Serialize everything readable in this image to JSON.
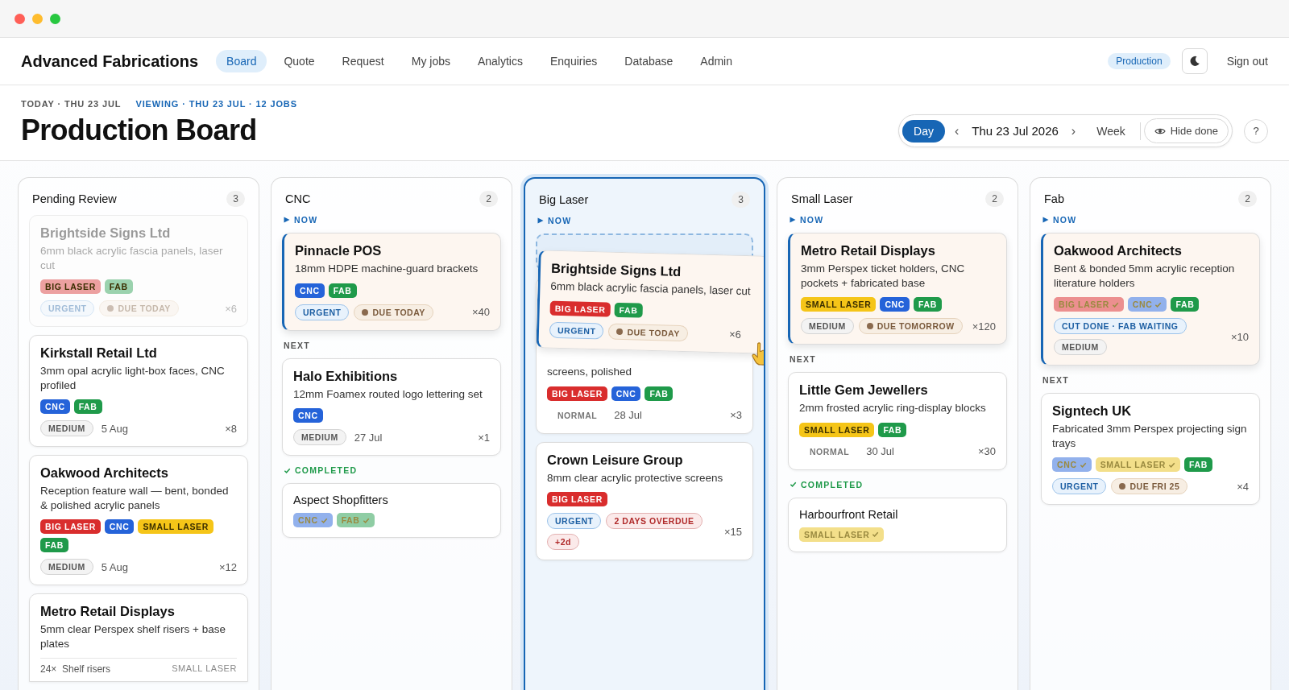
{
  "nav": {
    "brand": "Advanced Fabrications",
    "tabs": [
      {
        "label": "Board",
        "selected": true
      },
      {
        "label": "Quote",
        "selected": false
      },
      {
        "label": "Request",
        "selected": false
      },
      {
        "label": "My jobs",
        "selected": false
      },
      {
        "label": "Analytics",
        "selected": false
      },
      {
        "label": "Enquiries",
        "selected": false
      },
      {
        "label": "Database",
        "selected": false
      },
      {
        "label": "Admin",
        "selected": false
      }
    ],
    "environment": "Production",
    "sign_out": "Sign out"
  },
  "header": {
    "today": "TODAY · THU 23 JUL",
    "viewing": "VIEWING · THU 23 JUL · 12 JOBS",
    "title": "Production Board",
    "views": [
      {
        "label": "Day",
        "selected": true
      },
      {
        "label": "Week",
        "selected": false
      }
    ],
    "prev": "‹",
    "date": "Thu 23 Jul 2026",
    "next": "›",
    "hide_done": "Hide done",
    "help": "?"
  },
  "columns": [
    {
      "title": "Pending Review",
      "count": "3",
      "selected": false,
      "sections": [
        {
          "kind": "plain",
          "cards": [
            {
              "kind": "full",
              "faded": true,
              "active": false,
              "title": "Brightside Signs Ltd",
              "description": "6mm black acrylic fascia panels, laser cut",
              "stations": [
                {
                  "label": "BIG LASER",
                  "color": "#eca0a0",
                  "done": false
                },
                {
                  "label": "FAB",
                  "color": "#9bd2ae",
                  "done": false
                }
              ],
              "chips": [
                {
                  "kind": "urgent",
                  "label": "URGENT"
                },
                {
                  "kind": "due",
                  "label": "DUE TODAY"
                }
              ],
              "qty": "×6"
            },
            {
              "kind": "full",
              "faded": false,
              "active": false,
              "title": "Kirkstall Retail Ltd",
              "description": "3mm opal acrylic light-box faces, CNC profiled",
              "stations": [
                {
                  "label": "CNC",
                  "color": "#2563d9",
                  "done": false
                },
                {
                  "label": "FAB",
                  "color": "#1f9a4a",
                  "done": false
                }
              ],
              "chips": [
                {
                  "kind": "medium",
                  "label": "MEDIUM"
                }
              ],
              "date": "5 Aug",
              "qty": "×8"
            },
            {
              "kind": "full",
              "faded": false,
              "active": false,
              "title": "Oakwood Architects",
              "description": "Reception feature wall — bent, bonded & polished acrylic panels",
              "stations": [
                {
                  "label": "BIG LASER",
                  "color": "#d92d2d",
                  "done": false
                },
                {
                  "label": "CNC",
                  "color": "#2563d9",
                  "done": false
                },
                {
                  "label": "SMALL LASER",
                  "color": "#f5c518",
                  "done": false
                },
                {
                  "label": "FAB",
                  "color": "#1f9a4a",
                  "done": false
                }
              ],
              "chips": [
                {
                  "kind": "medium",
                  "label": "MEDIUM"
                }
              ],
              "date": "5 Aug",
              "qty": "×12"
            },
            {
              "kind": "summary",
              "title": "Metro Retail Displays",
              "description": "5mm clear Perspex shelf risers + base plates",
              "lines": [
                {
                  "qty": "24×",
                  "name": "Shelf risers",
                  "station": "SMALL LASER"
                }
              ]
            }
          ]
        }
      ]
    },
    {
      "title": "CNC",
      "count": "2",
      "selected": false,
      "sections": [
        {
          "kind": "now",
          "label": "NOW",
          "cards": [
            {
              "kind": "full",
              "faded": false,
              "active": true,
              "title": "Pinnacle POS",
              "description": "18mm HDPE machine-guard brackets",
              "stations": [
                {
                  "label": "CNC",
                  "color": "#2563d9",
                  "done": false
                },
                {
                  "label": "FAB",
                  "color": "#1f9a4a",
                  "done": false
                }
              ],
              "chips": [
                {
                  "kind": "urgent",
                  "label": "URGENT"
                },
                {
                  "kind": "due",
                  "label": "DUE TODAY"
                }
              ],
              "qty": "×40"
            }
          ]
        },
        {
          "kind": "next",
          "label": "NEXT",
          "cards": [
            {
              "kind": "full",
              "faded": false,
              "active": false,
              "title": "Halo Exhibitions",
              "description": "12mm Foamex routed logo lettering set",
              "stations": [
                {
                  "label": "CNC",
                  "color": "#2563d9",
                  "done": false
                }
              ],
              "chips": [
                {
                  "kind": "medium",
                  "label": "MEDIUM"
                }
              ],
              "date": "27 Jul",
              "qty": "×1"
            }
          ]
        },
        {
          "kind": "completed",
          "label": "COMPLETED",
          "cards": [
            {
              "kind": "done",
              "title": "Aspect Shopfitters",
              "stations": [
                {
                  "label": "CNC",
                  "color": "#92b1ec",
                  "done": true
                },
                {
                  "label": "FAB",
                  "color": "#8fcda4",
                  "done": true
                }
              ]
            }
          ]
        }
      ]
    },
    {
      "title": "Big Laser",
      "count": "3",
      "selected": true,
      "sections": [
        {
          "kind": "now",
          "label": "NOW",
          "cards": [
            {
              "kind": "dragged",
              "active": true,
              "title": "Brightside Signs Ltd",
              "description": "6mm black acrylic fascia panels, laser cut",
              "stations": [
                {
                  "label": "BIG LASER",
                  "color": "#d92d2d",
                  "done": false
                },
                {
                  "label": "FAB",
                  "color": "#1f9a4a",
                  "done": false
                }
              ],
              "chips": [
                {
                  "kind": "urgent",
                  "label": "URGENT"
                },
                {
                  "kind": "due",
                  "label": "DUE TODAY"
                }
              ],
              "qty": "×6"
            },
            {
              "kind": "partial",
              "description": "screens, polished",
              "stations": [
                {
                  "label": "BIG LASER",
                  "color": "#d92d2d",
                  "done": false
                },
                {
                  "label": "CNC",
                  "color": "#2563d9",
                  "done": false
                },
                {
                  "label": "FAB",
                  "color": "#1f9a4a",
                  "done": false
                }
              ],
              "chips": [
                {
                  "kind": "plain",
                  "label": "NORMAL"
                }
              ],
              "date": "28 Jul",
              "qty": "×3"
            },
            {
              "kind": "full",
              "faded": false,
              "active": false,
              "title": "Crown Leisure Group",
              "description": "8mm clear acrylic protective screens",
              "stations": [
                {
                  "label": "BIG LASER",
                  "color": "#d92d2d",
                  "done": false
                }
              ],
              "chips": [
                {
                  "kind": "urgent",
                  "label": "URGENT"
                },
                {
                  "kind": "overdue",
                  "label": "2 DAYS OVERDUE"
                },
                {
                  "kind": "overdue",
                  "label": "+2d"
                }
              ],
              "qty": "×15"
            }
          ]
        }
      ]
    },
    {
      "title": "Small Laser",
      "count": "2",
      "selected": false,
      "sections": [
        {
          "kind": "now",
          "label": "NOW",
          "cards": [
            {
              "kind": "full",
              "faded": false,
              "active": true,
              "title": "Metro Retail Displays",
              "description": "3mm Perspex ticket holders, CNC pockets + fabricated base",
              "stations": [
                {
                  "label": "SMALL LASER",
                  "color": "#f5c518",
                  "done": false
                },
                {
                  "label": "CNC",
                  "color": "#2563d9",
                  "done": false
                },
                {
                  "label": "FAB",
                  "color": "#1f9a4a",
                  "done": false
                }
              ],
              "chips": [
                {
                  "kind": "medium",
                  "label": "MEDIUM"
                },
                {
                  "kind": "due",
                  "label": "DUE TOMORROW"
                }
              ],
              "qty": "×120"
            }
          ]
        },
        {
          "kind": "next",
          "label": "NEXT",
          "cards": [
            {
              "kind": "full",
              "faded": false,
              "active": false,
              "title": "Little Gem Jewellers",
              "description": "2mm frosted acrylic ring-display blocks",
              "stations": [
                {
                  "label": "SMALL LASER",
                  "color": "#f5c518",
                  "done": false
                },
                {
                  "label": "FAB",
                  "color": "#1f9a4a",
                  "done": false
                }
              ],
              "chips": [
                {
                  "kind": "plain",
                  "label": "NORMAL"
                }
              ],
              "date": "30 Jul",
              "qty": "×30"
            }
          ]
        },
        {
          "kind": "completed",
          "label": "COMPLETED",
          "cards": [
            {
              "kind": "done",
              "title": "Harbourfront Retail",
              "stations": [
                {
                  "label": "SMALL LASER",
                  "color": "#f3df8a",
                  "done": true
                }
              ]
            }
          ]
        }
      ]
    },
    {
      "title": "Fab",
      "count": "2",
      "selected": false,
      "sections": [
        {
          "kind": "now",
          "label": "NOW",
          "cards": [
            {
              "kind": "full",
              "faded": false,
              "active": true,
              "title": "Oakwood Architects",
              "description": "Bent & bonded 5mm acrylic reception literature holders",
              "stations": [
                {
                  "label": "BIG LASER",
                  "color": "#ec8f8f",
                  "done": true
                },
                {
                  "label": "CNC",
                  "color": "#92b1ec",
                  "done": true
                },
                {
                  "label": "FAB",
                  "color": "#1f9a4a",
                  "done": false
                }
              ],
              "chips": [
                {
                  "kind": "status",
                  "label": "CUT DONE · FAB WAITING"
                },
                {
                  "kind": "medium",
                  "label": "MEDIUM"
                }
              ],
              "qty": "×10"
            }
          ]
        },
        {
          "kind": "next",
          "label": "NEXT",
          "cards": [
            {
              "kind": "full",
              "faded": false,
              "active": false,
              "title": "Signtech UK",
              "description": "Fabricated 3mm Perspex projecting sign trays",
              "stations": [
                {
                  "label": "CNC",
                  "color": "#92b1ec",
                  "done": true
                },
                {
                  "label": "SMALL LASER",
                  "color": "#f3df8a",
                  "done": true
                },
                {
                  "label": "FAB",
                  "color": "#1f9a4a",
                  "done": false
                }
              ],
              "chips": [
                {
                  "kind": "urgent",
                  "label": "URGENT"
                },
                {
                  "kind": "due",
                  "label": "DUE FRI 25"
                }
              ],
              "qty": "×4"
            }
          ]
        }
      ]
    }
  ]
}
